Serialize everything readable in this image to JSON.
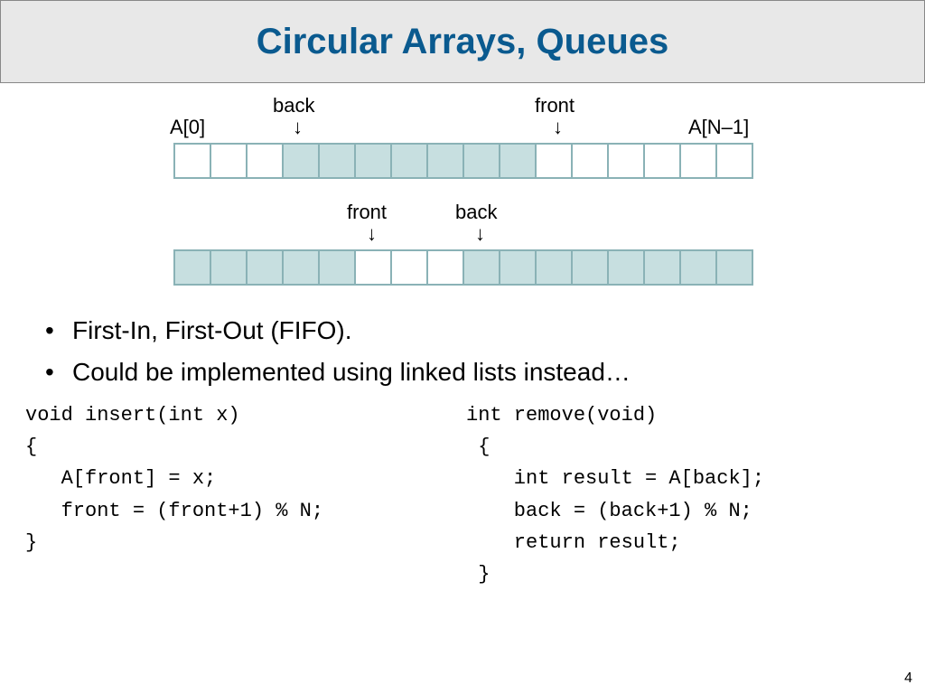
{
  "title": "Circular Arrays, Queues",
  "array1": {
    "left_label": "A[0]",
    "right_label": "A[N–1]",
    "back_label": "back",
    "front_label": "front",
    "cells": [
      0,
      0,
      0,
      1,
      1,
      1,
      1,
      1,
      1,
      1,
      0,
      0,
      0,
      0,
      0,
      0
    ]
  },
  "array2": {
    "front_label": "front",
    "back_label": "back",
    "cells": [
      1,
      1,
      1,
      1,
      1,
      0,
      0,
      0,
      1,
      1,
      1,
      1,
      1,
      1,
      1,
      1
    ]
  },
  "bullets": [
    "First-In, First-Out (FIFO).",
    "Could be implemented using linked lists instead…"
  ],
  "code": {
    "insert": "void insert(int x)\n{\n   A[front] = x;\n   front = (front+1) % N;\n}",
    "remove": "int remove(void)\n {\n    int result = A[back];\n    back = (back+1) % N;\n    return result;\n }"
  },
  "page_number": "4"
}
